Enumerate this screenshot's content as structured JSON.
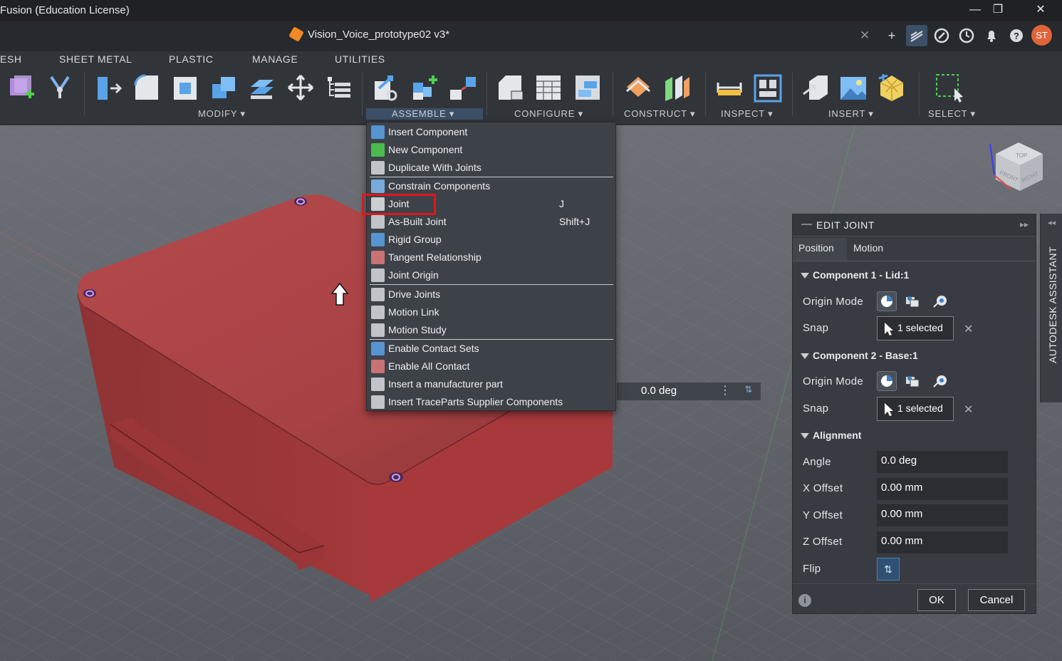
{
  "window": {
    "title": "Fusion (Education License)",
    "minimize_glyph": "—",
    "restore_glyph": "❐",
    "close_glyph": "✕"
  },
  "doc_tab": {
    "name": "Vision_Voice_prototype02 v3*",
    "close_glyph": "✕"
  },
  "tab_icons": [
    "plus-icon",
    "data-panel-icon",
    "extensions-icon",
    "job-status-icon",
    "notifications-icon",
    "help-icon"
  ],
  "user_initials": "ST",
  "ribbon": {
    "tabs": [
      "ESH",
      "SHEET METAL",
      "PLASTIC",
      "MANAGE",
      "UTILITIES"
    ],
    "groups": {
      "modify": "MODIFY ▾",
      "assemble": "ASSEMBLE ▾",
      "configure": "CONFIGURE ▾",
      "construct": "CONSTRUCT ▾",
      "inspect": "INSPECT ▾",
      "insert": "INSERT ▾",
      "select": "SELECT ▾"
    }
  },
  "assemble_menu": {
    "items": [
      {
        "label": "Insert Component",
        "shortcut": "",
        "icon": "insert-component-icon"
      },
      {
        "label": "New Component",
        "shortcut": "",
        "icon": "new-component-icon"
      },
      {
        "label": "Duplicate With Joints",
        "shortcut": "",
        "icon": "duplicate-with-joints-icon"
      },
      {
        "label": "Constrain Components",
        "shortcut": "",
        "icon": "constrain-components-icon"
      },
      {
        "label": "Joint",
        "shortcut": "J",
        "icon": "joint-icon"
      },
      {
        "label": "As-Built Joint",
        "shortcut": "Shift+J",
        "icon": "as-built-joint-icon"
      },
      {
        "label": "Rigid Group",
        "shortcut": "",
        "icon": "rigid-group-icon"
      },
      {
        "label": "Tangent Relationship",
        "shortcut": "",
        "icon": "tangent-relationship-icon"
      },
      {
        "label": "Joint Origin",
        "shortcut": "",
        "icon": "joint-origin-icon"
      },
      {
        "label": "Drive Joints",
        "shortcut": "",
        "icon": "drive-joints-icon"
      },
      {
        "label": "Motion Link",
        "shortcut": "",
        "icon": "motion-link-icon"
      },
      {
        "label": "Motion Study",
        "shortcut": "",
        "icon": "motion-study-icon"
      },
      {
        "label": "Enable Contact Sets",
        "shortcut": "",
        "icon": "enable-contact-sets-icon"
      },
      {
        "label": "Enable All Contact",
        "shortcut": "",
        "icon": "enable-all-contact-icon"
      },
      {
        "label": "Insert a manufacturer part",
        "shortcut": "",
        "icon": "manufacturer-part-icon"
      },
      {
        "label": "Insert TraceParts Supplier Components",
        "shortcut": "",
        "icon": "traceparts-icon"
      }
    ],
    "highlighted": "Joint"
  },
  "viewport_angle": {
    "value": "0.0 deg",
    "menu_glyph": "⋮",
    "flip_glyph": "⇅"
  },
  "view_cube": {
    "top": "TOP",
    "front": "FRONT",
    "right": "RIGHT"
  },
  "edit_joint": {
    "title": "EDIT JOINT",
    "collapse_glyph": "—",
    "expand_glyph": "▸▸",
    "tabs": {
      "position": "Position",
      "motion": "Motion"
    },
    "component1": {
      "header": "Component 1 - Lid:1",
      "origin_mode_label": "Origin Mode",
      "snap_label": "Snap",
      "snap_value": "1 selected"
    },
    "component2": {
      "header": "Component 2 - Base:1",
      "origin_mode_label": "Origin Mode",
      "snap_label": "Snap",
      "snap_value": "1 selected"
    },
    "alignment": {
      "header": "Alignment",
      "angle_label": "Angle",
      "angle_value": "0.0 deg",
      "x_label": "X Offset",
      "x_value": "0.00 mm",
      "y_label": "Y Offset",
      "y_value": "0.00 mm",
      "z_label": "Z Offset",
      "z_value": "0.00 mm",
      "flip_label": "Flip"
    },
    "clear_glyph": "✕",
    "info_glyph": "i",
    "ok_label": "OK",
    "cancel_label": "Cancel"
  },
  "assistant": {
    "label": "AUTODESK ASSISTANT",
    "collapse_glyph": "◂◂"
  },
  "colors": {
    "accent_blue": "#3d4f66",
    "highlight_red": "#e0161c",
    "model_red": "#a3393b",
    "avatar": "#e1653a"
  }
}
